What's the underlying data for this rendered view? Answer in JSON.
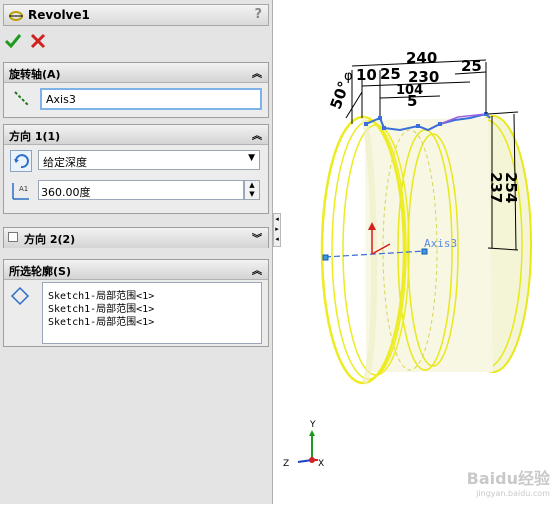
{
  "feature": {
    "title": "Revolve1",
    "help_label": "?"
  },
  "groups": {
    "axis": {
      "title": "旋转轴(A)",
      "value": "Axis3"
    },
    "direction1": {
      "title": "方向 1(1)",
      "end_condition": "给定深度",
      "angle": "360.00度"
    },
    "direction2": {
      "title": "方向 2(2)"
    },
    "profiles": {
      "title": "所选轮廓(S)",
      "items": [
        "Sketch1-局部范围<1>",
        "Sketch1-局部范围<1>",
        "Sketch1-局部范围<1>"
      ]
    }
  },
  "dimensions": {
    "d240": "240",
    "d25a": "25",
    "d25b": "25",
    "d230": "230",
    "d104": "104",
    "d10": "10",
    "d5": "5",
    "d50": "50°",
    "d254": "254",
    "d237": "237",
    "dphi": "φ"
  },
  "viewport": {
    "axis_label": "Axis3",
    "triad": {
      "x": "X",
      "y": "Y",
      "z": "Z"
    },
    "watermark": "Baidu经验",
    "watermark_sub": "jingyan.baidu.com"
  },
  "colors": {
    "model_edge": "#f2f226",
    "model_fill": "#f6f6dc",
    "dimension": "#000000",
    "sketch": "#3a6ed8"
  }
}
